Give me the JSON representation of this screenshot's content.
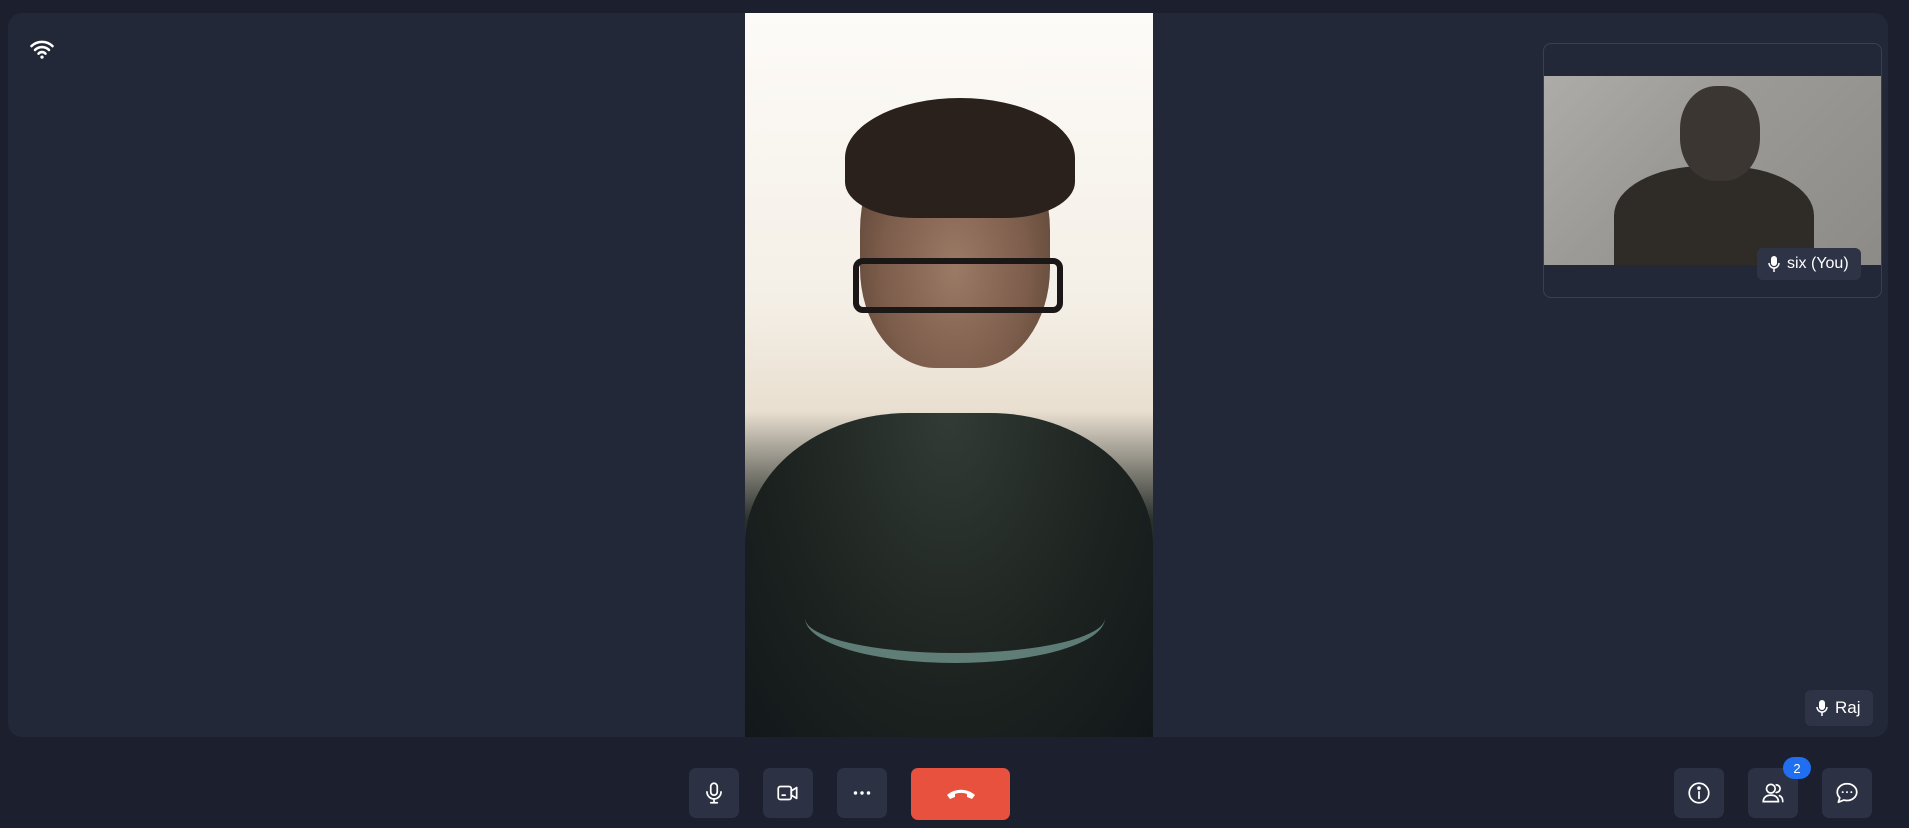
{
  "participants": {
    "main": {
      "name": "Raj",
      "icon": "mic-icon"
    },
    "self": {
      "name": "six (You)",
      "icon": "mic-icon"
    }
  },
  "status": {
    "icon": "wifi-icon"
  },
  "controls": {
    "mic": {
      "icon": "mic-icon"
    },
    "camera": {
      "icon": "video-camera-icon"
    },
    "more": {
      "icon": "more-horizontal-icon"
    },
    "end_call": {
      "icon": "phone-hangup-icon",
      "color": "#e8513d"
    },
    "info": {
      "icon": "info-icon"
    },
    "participants": {
      "icon": "people-icon",
      "badge": "2"
    },
    "chat": {
      "icon": "chat-icon"
    }
  },
  "colors": {
    "background": "#1b1f2e",
    "stage": "#232838",
    "control": "#2c3243",
    "badge": "#1f6ff0"
  }
}
